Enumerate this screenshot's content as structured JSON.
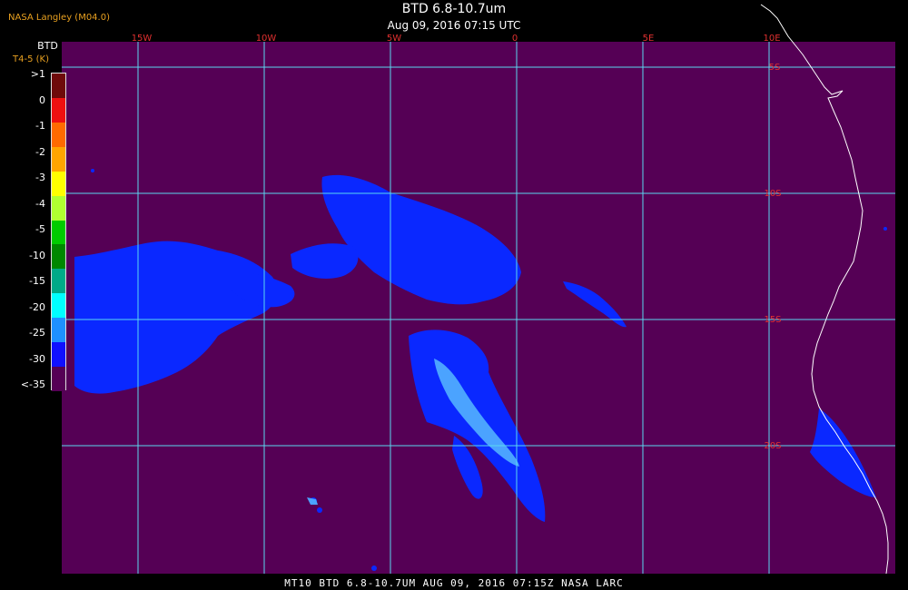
{
  "header": {
    "source": "NASA Langley (M04.0)",
    "title": "BTD 6.8-10.7um",
    "subtitle": "Aug 09, 2016 07:15 UTC"
  },
  "legend": {
    "title": "BTD",
    "units": "T4-5 (K)",
    "labels": [
      ">1",
      "0",
      "-1",
      "-2",
      "-3",
      "-4",
      "-5",
      "-10",
      "-15",
      "-20",
      "-25",
      "-30",
      "<-35"
    ],
    "colors": [
      "#6e0a0a",
      "#ee1010",
      "#ff6a00",
      "#ffa500",
      "#ffff00",
      "#b0ff30",
      "#00cc00",
      "#008800",
      "#00aa88",
      "#00ffff",
      "#1e90ff",
      "#1010ff",
      "#550055"
    ]
  },
  "map": {
    "background_color": "#550055",
    "grid_color": "#5ad8f0",
    "signal_color": "#0a28ff",
    "strong_signal_color": "#4ba3ff",
    "coast_color": "#ffffff",
    "lon_labels": [
      "15W",
      "10W",
      "5W",
      "0",
      "5E",
      "10E"
    ],
    "lat_labels": [
      "5S",
      "10S",
      "15S",
      "20S"
    ]
  },
  "footer": {
    "text": "MT10   BTD 6.8-10.7UM    AUG 09, 2016 07:15Z   NASA LARC"
  }
}
